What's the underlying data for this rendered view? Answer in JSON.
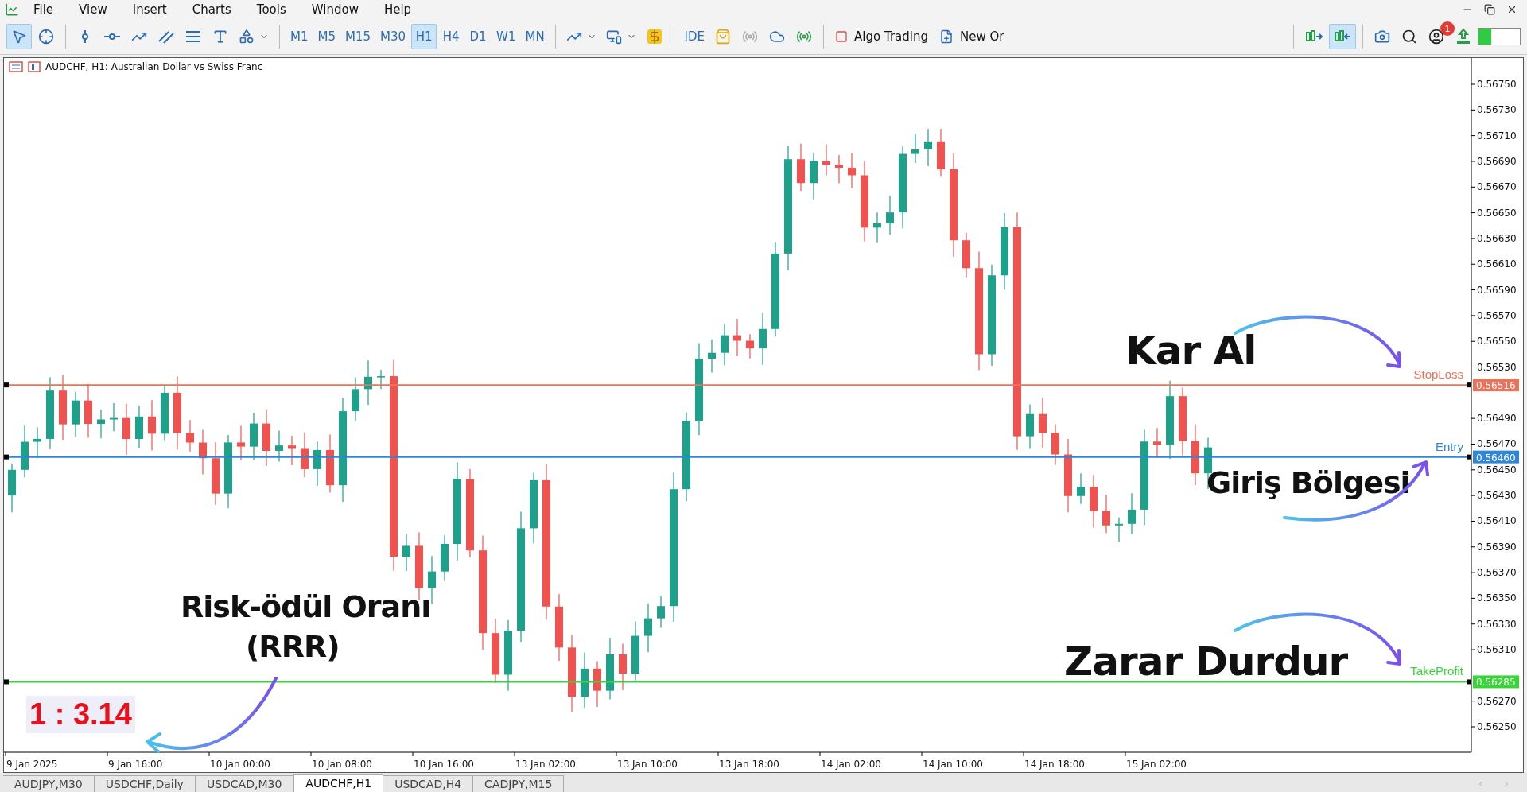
{
  "menu": [
    "File",
    "View",
    "Insert",
    "Charts",
    "Tools",
    "Window",
    "Help"
  ],
  "timeframes": [
    {
      "label": "M1",
      "selected": false
    },
    {
      "label": "M5",
      "selected": false
    },
    {
      "label": "M15",
      "selected": false
    },
    {
      "label": "M30",
      "selected": false
    },
    {
      "label": "H1",
      "selected": true
    },
    {
      "label": "H4",
      "selected": false
    },
    {
      "label": "D1",
      "selected": false
    },
    {
      "label": "W1",
      "selected": false
    },
    {
      "label": "MN",
      "selected": false
    }
  ],
  "toolbar_buttons": [
    {
      "kind": "ide",
      "label": "IDE"
    },
    {
      "kind": "algo",
      "label": "Algo Trading"
    },
    {
      "kind": "order",
      "label": "New Or"
    }
  ],
  "notification_count": "1",
  "chart": {
    "title": "AUDCHF, H1:  Australian Dollar vs Swiss Franc",
    "price_axis": [
      "0.56750",
      "0.56730",
      "0.56710",
      "0.56690",
      "0.56670",
      "0.56650",
      "0.56630",
      "0.56610",
      "0.56590",
      "0.56570",
      "0.56550",
      "0.56530",
      "0.56490",
      "0.56470",
      "0.56450",
      "0.56430",
      "0.56410",
      "0.56390",
      "0.56370",
      "0.56350",
      "0.56330",
      "0.56310",
      "0.56270",
      "0.56250"
    ],
    "time_axis": [
      "9 Jan 2025",
      "9 Jan 16:00",
      "10 Jan 00:00",
      "10 Jan 08:00",
      "10 Jan 16:00",
      "13 Jan 02:00",
      "13 Jan 10:00",
      "13 Jan 18:00",
      "14 Jan 02:00",
      "14 Jan 10:00",
      "14 Jan 18:00",
      "15 Jan 02:00"
    ],
    "levels": [
      {
        "label": "StopLoss",
        "price": "0.56516",
        "color": "#e8735a"
      },
      {
        "label": "Entry",
        "price": "0.56460",
        "color": "#2f86d8"
      },
      {
        "label": "TakeProfit",
        "price": "0.56285",
        "color": "#35d635"
      }
    ],
    "ratio": "1 : 3.14",
    "annotations": [
      {
        "kind": "take",
        "text": "Kar Al"
      },
      {
        "kind": "entry",
        "text": "Giriş Bölgesi"
      },
      {
        "kind": "rrr",
        "text": "Risk-ödül Oranı",
        "text2": "(RRR)"
      },
      {
        "kind": "stop",
        "text": "Zarar Durdur"
      }
    ]
  },
  "tabs": [
    {
      "label": "AUDJPY,M30",
      "selected": false
    },
    {
      "label": "USDCHF,Daily",
      "selected": false
    },
    {
      "label": "USDCAD,M30",
      "selected": false
    },
    {
      "label": "AUDCHF,H1",
      "selected": true
    },
    {
      "label": "USDCAD,H4",
      "selected": false
    },
    {
      "label": "CADJPY,M15",
      "selected": false
    }
  ]
}
